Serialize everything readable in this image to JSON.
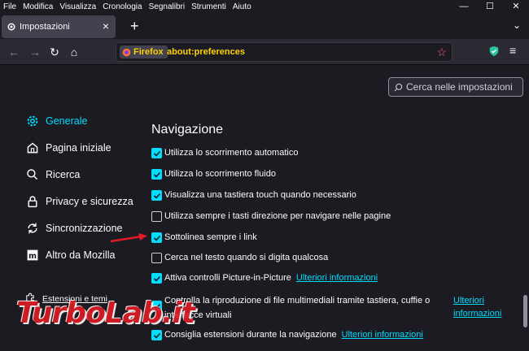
{
  "menubar": {
    "items": [
      "File",
      "Modifica",
      "Visualizza",
      "Cronologia",
      "Segnalibri",
      "Strumenti",
      "Aiuto"
    ]
  },
  "tab": {
    "label": "Impostazioni"
  },
  "urlbar": {
    "brand": "Firefox",
    "url": "about:preferences"
  },
  "search": {
    "placeholder": "Cerca nelle impostazioni"
  },
  "sidebar": {
    "items": [
      {
        "label": "Generale",
        "icon": "gear-icon",
        "active": true
      },
      {
        "label": "Pagina iniziale",
        "icon": "home-icon"
      },
      {
        "label": "Ricerca",
        "icon": "search-icon"
      },
      {
        "label": "Privacy e sicurezza",
        "icon": "lock-icon"
      },
      {
        "label": "Sincronizzazione",
        "icon": "sync-icon"
      },
      {
        "label": "Altro da Mozilla",
        "icon": "mozilla-icon"
      }
    ],
    "extensions_label": "Estensioni e temi"
  },
  "main": {
    "section_title": "Navigazione",
    "options": [
      {
        "label": "Utilizza lo scorrimento automatico",
        "checked": true
      },
      {
        "label": "Utilizza lo scorrimento fluido",
        "checked": true
      },
      {
        "label": "Visualizza una tastiera touch quando necessario",
        "checked": true
      },
      {
        "label": "Utilizza sempre i tasti direzione per navigare nelle pagine",
        "checked": false
      },
      {
        "label": "Sottolinea sempre i link",
        "checked": true
      },
      {
        "label": "Cerca nel testo quando si digita qualcosa",
        "checked": false
      },
      {
        "label": "Attiva controlli Picture-in-Picture",
        "checked": true,
        "link": "Ulteriori informazioni"
      },
      {
        "label": "Controlla la riproduzione di file multimediali tramite tastiera, cuffie o interfacce virtuali",
        "checked": true,
        "link": "Ulteriori informazioni"
      },
      {
        "label": "Consiglia estensioni durante la navigazione",
        "checked": true,
        "link": "Ulteriori informazioni"
      }
    ]
  },
  "colors": {
    "accent": "#00ddff",
    "url_text": "#fbd204",
    "arrow": "#e01b24"
  },
  "watermark": "TurboLab.it"
}
